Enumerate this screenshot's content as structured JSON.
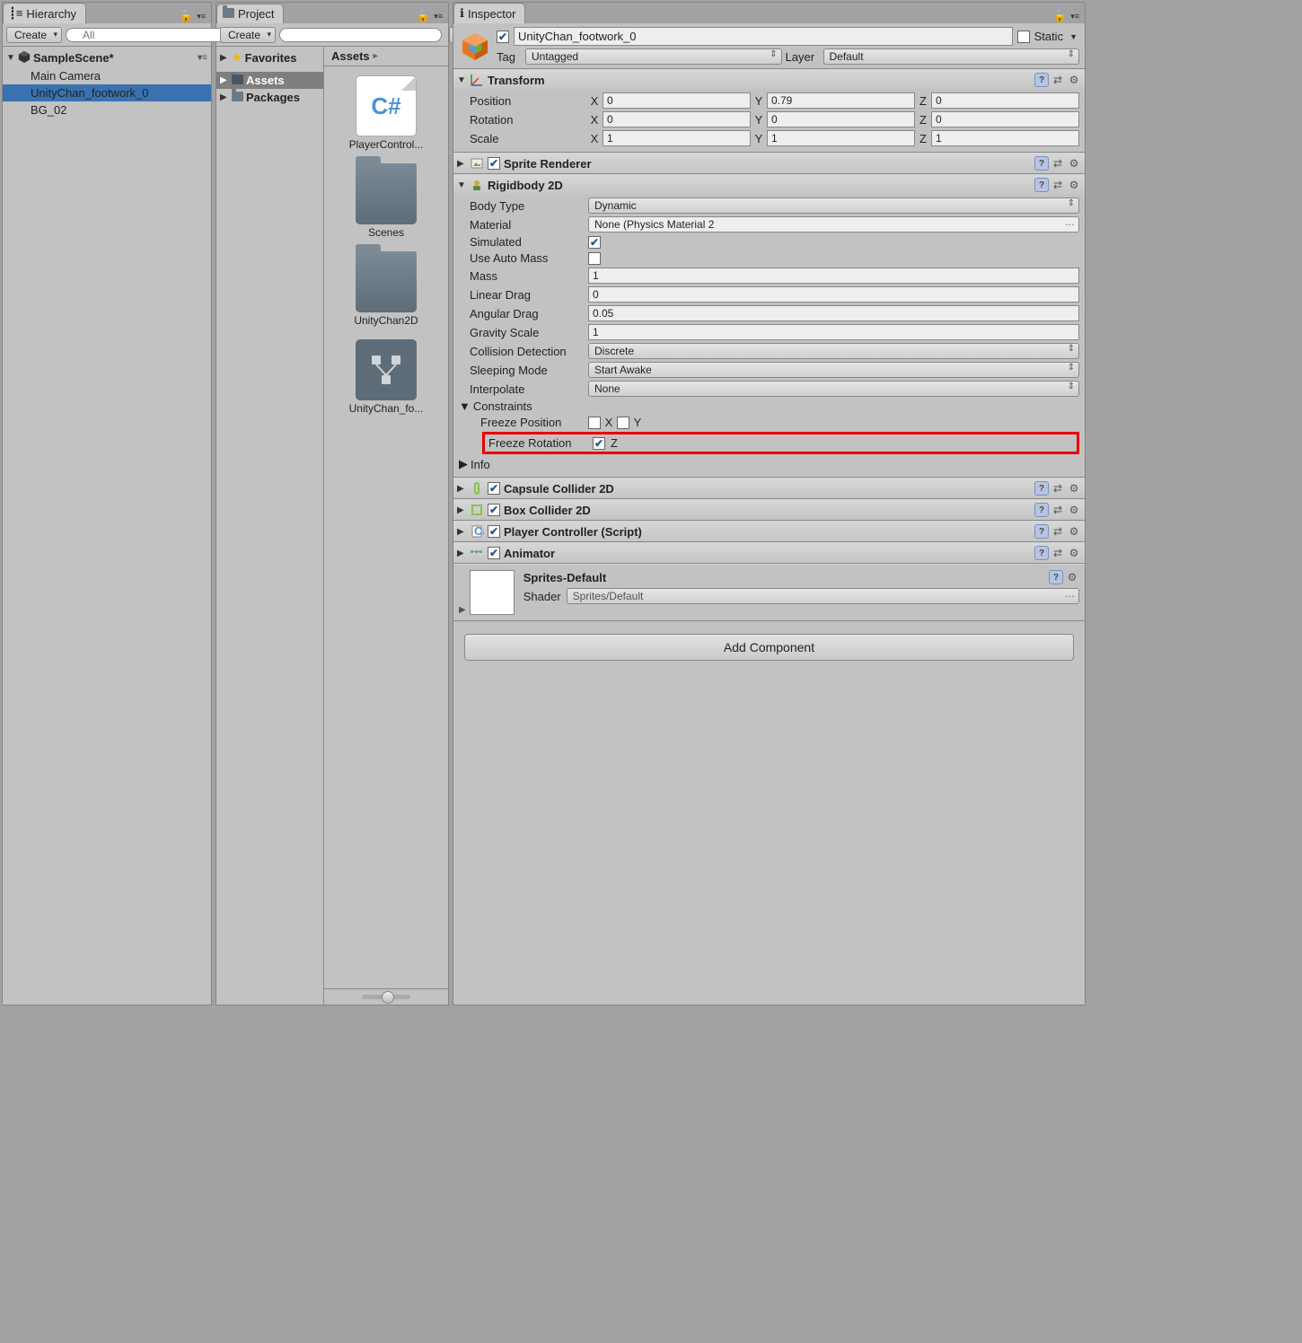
{
  "hierarchy": {
    "tab": "Hierarchy",
    "create": "Create",
    "search_ph": "All",
    "scene": "SampleScene*",
    "items": [
      "Main Camera",
      "UnityChan_footwork_0",
      "BG_02"
    ],
    "selected": 1
  },
  "project": {
    "tab": "Project",
    "create": "Create",
    "favorites": "Favorites",
    "folders": [
      "Assets",
      "Packages"
    ],
    "selected_folder": 0,
    "assets_header": "Assets",
    "assets": [
      {
        "name": "PlayerControl...",
        "type": "cs"
      },
      {
        "name": "Scenes",
        "type": "folder"
      },
      {
        "name": "UnityChan2D",
        "type": "folder"
      },
      {
        "name": "UnityChan_fo...",
        "type": "prefab"
      }
    ]
  },
  "inspector": {
    "tab": "Inspector",
    "go_name": "UnityChan_footwork_0",
    "static": "Static",
    "tag_lbl": "Tag",
    "tag_val": "Untagged",
    "layer_lbl": "Layer",
    "layer_val": "Default",
    "transform": {
      "title": "Transform",
      "position": {
        "label": "Position",
        "x": "0",
        "y": "0.79",
        "z": "0"
      },
      "rotation": {
        "label": "Rotation",
        "x": "0",
        "y": "0",
        "z": "0"
      },
      "scale": {
        "label": "Scale",
        "x": "1",
        "y": "1",
        "z": "1"
      }
    },
    "sprite_renderer": "Sprite Renderer",
    "rigidbody": {
      "title": "Rigidbody 2D",
      "body_type": {
        "label": "Body Type",
        "value": "Dynamic"
      },
      "material": {
        "label": "Material",
        "value": "None (Physics Material 2"
      },
      "simulated": {
        "label": "Simulated",
        "value": true
      },
      "auto_mass": {
        "label": "Use Auto Mass",
        "value": false
      },
      "mass": {
        "label": "Mass",
        "value": "1"
      },
      "linear_drag": {
        "label": "Linear Drag",
        "value": "0"
      },
      "angular_drag": {
        "label": "Angular Drag",
        "value": "0.05"
      },
      "gravity": {
        "label": "Gravity Scale",
        "value": "1"
      },
      "collision": {
        "label": "Collision Detection",
        "value": "Discrete"
      },
      "sleeping": {
        "label": "Sleeping Mode",
        "value": "Start Awake"
      },
      "interpolate": {
        "label": "Interpolate",
        "value": "None"
      },
      "constraints": "Constraints",
      "freeze_pos": "Freeze Position",
      "freeze_rot": "Freeze Rotation",
      "info": "Info"
    },
    "capsule": "Capsule Collider 2D",
    "box": "Box Collider 2D",
    "player_ctrl": "Player Controller (Script)",
    "animator": "Animator",
    "material": {
      "name": "Sprites-Default",
      "shader_lbl": "Shader",
      "shader": "Sprites/Default"
    },
    "add_component": "Add Component"
  }
}
